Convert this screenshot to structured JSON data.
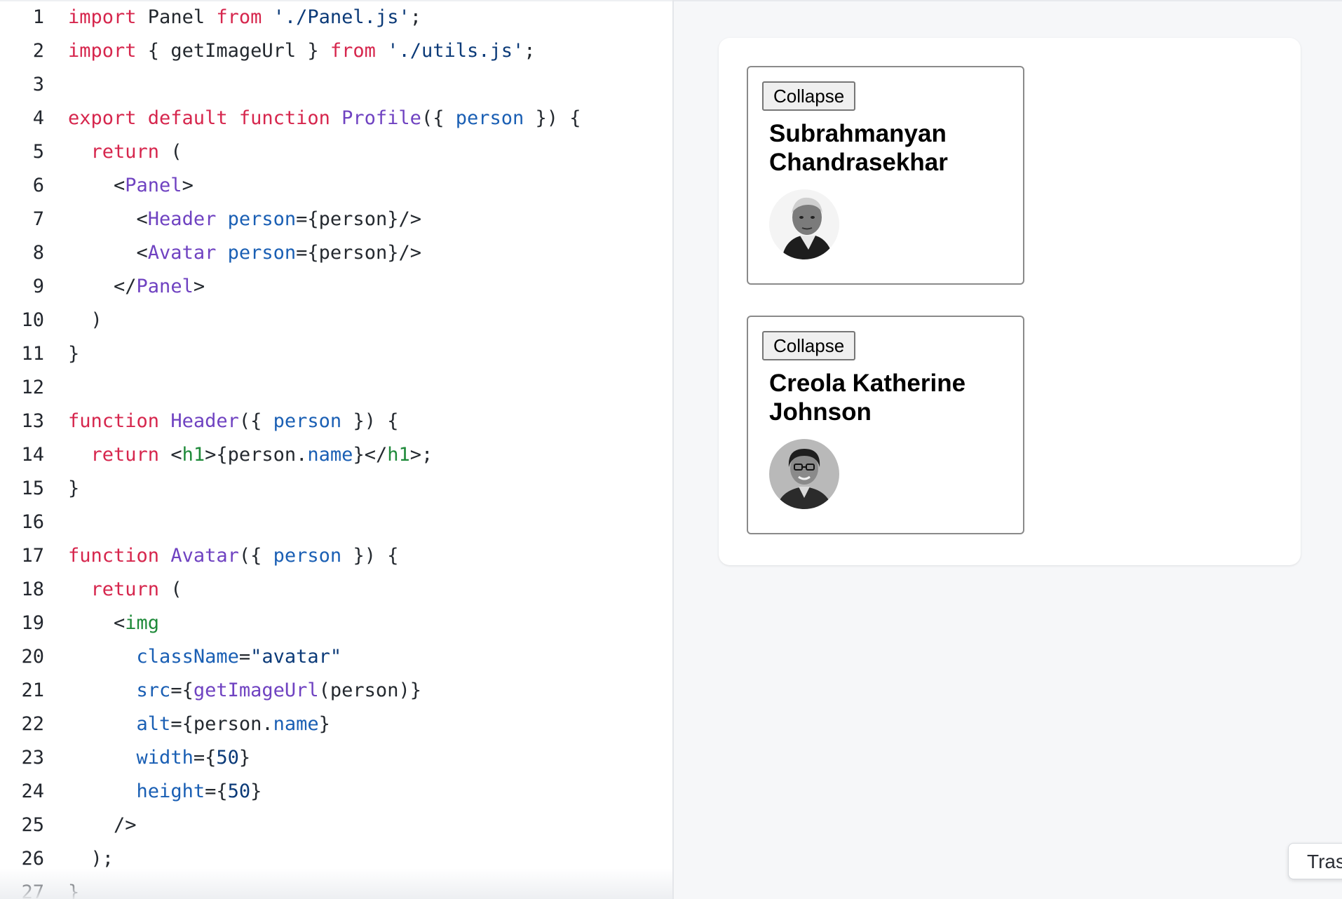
{
  "editor": {
    "lines": [
      {
        "n": "1",
        "tokens": [
          {
            "t": "import",
            "c": "kw"
          },
          {
            "t": " Panel ",
            "c": "pl"
          },
          {
            "t": "from",
            "c": "kw"
          },
          {
            "t": " ",
            "c": "pl"
          },
          {
            "t": "'./Panel.js'",
            "c": "str"
          },
          {
            "t": ";",
            "c": "pl"
          }
        ]
      },
      {
        "n": "2",
        "tokens": [
          {
            "t": "import",
            "c": "kw"
          },
          {
            "t": " { getImageUrl } ",
            "c": "pl"
          },
          {
            "t": "from",
            "c": "kw"
          },
          {
            "t": " ",
            "c": "pl"
          },
          {
            "t": "'./utils.js'",
            "c": "str"
          },
          {
            "t": ";",
            "c": "pl"
          }
        ]
      },
      {
        "n": "3",
        "tokens": []
      },
      {
        "n": "4",
        "tokens": [
          {
            "t": "export default function",
            "c": "kw"
          },
          {
            "t": " ",
            "c": "pl"
          },
          {
            "t": "Profile",
            "c": "fn"
          },
          {
            "t": "({ ",
            "c": "pl"
          },
          {
            "t": "person",
            "c": "var"
          },
          {
            "t": " }) {",
            "c": "pl"
          }
        ]
      },
      {
        "n": "5",
        "tokens": [
          {
            "t": "  ",
            "c": "pl"
          },
          {
            "t": "return",
            "c": "kw"
          },
          {
            "t": " (",
            "c": "pl"
          }
        ]
      },
      {
        "n": "6",
        "tokens": [
          {
            "t": "    <",
            "c": "pl"
          },
          {
            "t": "Panel",
            "c": "fn"
          },
          {
            "t": ">",
            "c": "pl"
          }
        ]
      },
      {
        "n": "7",
        "tokens": [
          {
            "t": "      <",
            "c": "pl"
          },
          {
            "t": "Header",
            "c": "fn"
          },
          {
            "t": " ",
            "c": "pl"
          },
          {
            "t": "person",
            "c": "var"
          },
          {
            "t": "={person}/>",
            "c": "pl"
          }
        ]
      },
      {
        "n": "8",
        "tokens": [
          {
            "t": "      <",
            "c": "pl"
          },
          {
            "t": "Avatar",
            "c": "fn"
          },
          {
            "t": " ",
            "c": "pl"
          },
          {
            "t": "person",
            "c": "var"
          },
          {
            "t": "={person}/>",
            "c": "pl"
          }
        ]
      },
      {
        "n": "9",
        "tokens": [
          {
            "t": "    </",
            "c": "pl"
          },
          {
            "t": "Panel",
            "c": "fn"
          },
          {
            "t": ">",
            "c": "pl"
          }
        ]
      },
      {
        "n": "10",
        "tokens": [
          {
            "t": "  )",
            "c": "pl"
          }
        ]
      },
      {
        "n": "11",
        "tokens": [
          {
            "t": "}",
            "c": "pl"
          }
        ]
      },
      {
        "n": "12",
        "tokens": []
      },
      {
        "n": "13",
        "tokens": [
          {
            "t": "function",
            "c": "kw"
          },
          {
            "t": " ",
            "c": "pl"
          },
          {
            "t": "Header",
            "c": "fn"
          },
          {
            "t": "({ ",
            "c": "pl"
          },
          {
            "t": "person",
            "c": "var"
          },
          {
            "t": " }) {",
            "c": "pl"
          }
        ]
      },
      {
        "n": "14",
        "tokens": [
          {
            "t": "  ",
            "c": "pl"
          },
          {
            "t": "return",
            "c": "kw"
          },
          {
            "t": " <",
            "c": "pl"
          },
          {
            "t": "h1",
            "c": "tag"
          },
          {
            "t": ">{person.",
            "c": "pl"
          },
          {
            "t": "name",
            "c": "var"
          },
          {
            "t": "}</",
            "c": "pl"
          },
          {
            "t": "h1",
            "c": "tag"
          },
          {
            "t": ">;",
            "c": "pl"
          }
        ]
      },
      {
        "n": "15",
        "tokens": [
          {
            "t": "}",
            "c": "pl"
          }
        ]
      },
      {
        "n": "16",
        "tokens": []
      },
      {
        "n": "17",
        "tokens": [
          {
            "t": "function",
            "c": "kw"
          },
          {
            "t": " ",
            "c": "pl"
          },
          {
            "t": "Avatar",
            "c": "fn"
          },
          {
            "t": "({ ",
            "c": "pl"
          },
          {
            "t": "person",
            "c": "var"
          },
          {
            "t": " }) {",
            "c": "pl"
          }
        ]
      },
      {
        "n": "18",
        "tokens": [
          {
            "t": "  ",
            "c": "pl"
          },
          {
            "t": "return",
            "c": "kw"
          },
          {
            "t": " (",
            "c": "pl"
          }
        ]
      },
      {
        "n": "19",
        "tokens": [
          {
            "t": "    <",
            "c": "pl"
          },
          {
            "t": "img",
            "c": "tag"
          }
        ]
      },
      {
        "n": "20",
        "tokens": [
          {
            "t": "      ",
            "c": "pl"
          },
          {
            "t": "className",
            "c": "var"
          },
          {
            "t": "=",
            "c": "pl"
          },
          {
            "t": "\"avatar\"",
            "c": "str"
          }
        ]
      },
      {
        "n": "21",
        "tokens": [
          {
            "t": "      ",
            "c": "pl"
          },
          {
            "t": "src",
            "c": "var"
          },
          {
            "t": "={",
            "c": "pl"
          },
          {
            "t": "getImageUrl",
            "c": "fn"
          },
          {
            "t": "(person)}",
            "c": "pl"
          }
        ]
      },
      {
        "n": "22",
        "tokens": [
          {
            "t": "      ",
            "c": "pl"
          },
          {
            "t": "alt",
            "c": "var"
          },
          {
            "t": "={person.",
            "c": "pl"
          },
          {
            "t": "name",
            "c": "var"
          },
          {
            "t": "}",
            "c": "pl"
          }
        ]
      },
      {
        "n": "23",
        "tokens": [
          {
            "t": "      ",
            "c": "pl"
          },
          {
            "t": "width",
            "c": "var"
          },
          {
            "t": "={",
            "c": "pl"
          },
          {
            "t": "50",
            "c": "str"
          },
          {
            "t": "}",
            "c": "pl"
          }
        ]
      },
      {
        "n": "24",
        "tokens": [
          {
            "t": "      ",
            "c": "pl"
          },
          {
            "t": "height",
            "c": "var"
          },
          {
            "t": "={",
            "c": "pl"
          },
          {
            "t": "50",
            "c": "str"
          },
          {
            "t": "}",
            "c": "pl"
          }
        ]
      },
      {
        "n": "25",
        "tokens": [
          {
            "t": "    />",
            "c": "pl"
          }
        ]
      },
      {
        "n": "26",
        "tokens": [
          {
            "t": "  );",
            "c": "pl"
          }
        ]
      },
      {
        "n": "27",
        "tokens": [
          {
            "t": "}",
            "c": "pl"
          }
        ]
      }
    ]
  },
  "preview": {
    "panels": [
      {
        "button_label": "Collapse",
        "name": "Subrahmanyan Chandrasekhar"
      },
      {
        "button_label": "Collapse",
        "name": "Creola Katherine Johnson"
      }
    ]
  },
  "tooltip": {
    "text": "Tras"
  },
  "colors": {
    "keyword": "#d6264d",
    "function": "#6f42c1",
    "variable": "#1a5fb4",
    "string": "#0b3a78",
    "tag": "#1f8a3a",
    "plain": "#24292f"
  }
}
